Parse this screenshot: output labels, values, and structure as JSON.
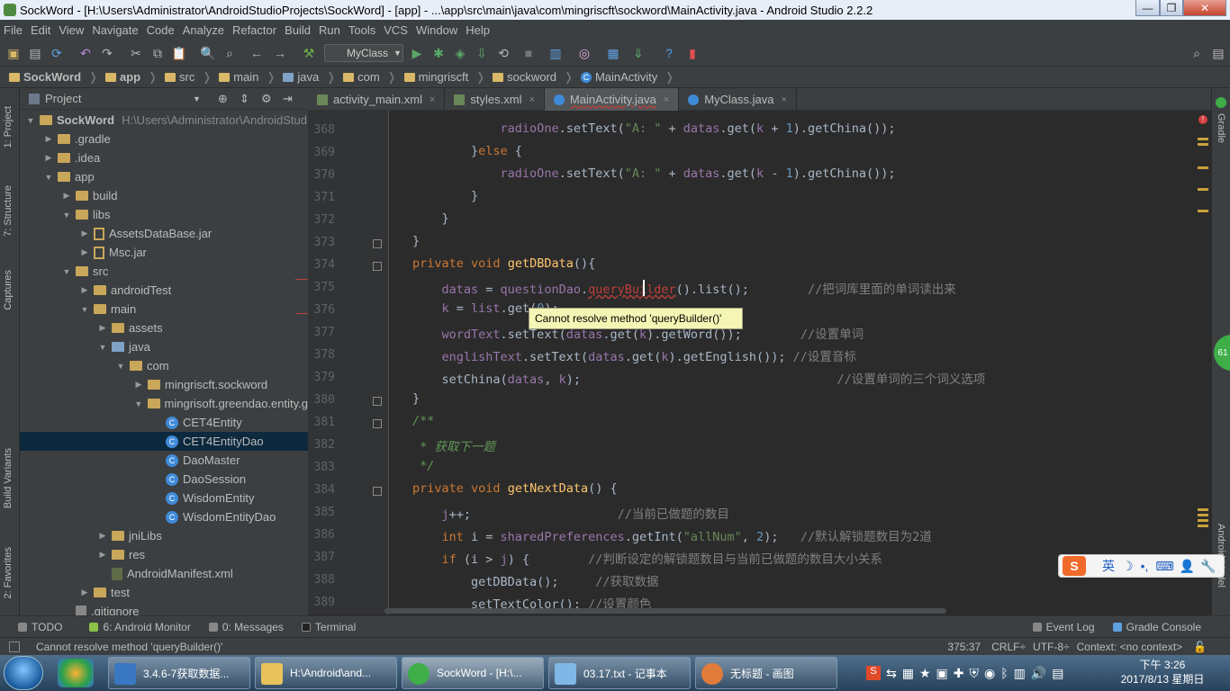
{
  "window": {
    "title": "SockWord - [H:\\Users\\Administrator\\AndroidStudioProjects\\SockWord] - [app] - ...\\app\\src\\main\\java\\com\\mingriscft\\sockword\\MainActivity.java - Android Studio 2.2.2"
  },
  "menu": [
    "File",
    "Edit",
    "View",
    "Navigate",
    "Code",
    "Analyze",
    "Refactor",
    "Build",
    "Run",
    "Tools",
    "VCS",
    "Window",
    "Help"
  ],
  "toolbar": {
    "run_config": "MyClass"
  },
  "breadcrumbs": [
    "SockWord",
    "app",
    "src",
    "main",
    "java",
    "com",
    "mingriscft",
    "sockword",
    "MainActivity"
  ],
  "project": {
    "header": "Project",
    "tree": [
      {
        "label": "SockWord",
        "extra": "H:\\Users\\Administrator\\AndroidStud",
        "depth": 0,
        "icon": "folder-icon",
        "expanded": true
      },
      {
        "label": ".gradle",
        "depth": 1,
        "icon": "folder-icon",
        "expanded": false
      },
      {
        "label": ".idea",
        "depth": 1,
        "icon": "folder-icon",
        "expanded": false
      },
      {
        "label": "app",
        "depth": 1,
        "icon": "folder-icon",
        "expanded": true
      },
      {
        "label": "build",
        "depth": 2,
        "icon": "folder-icon",
        "expanded": false
      },
      {
        "label": "libs",
        "depth": 2,
        "icon": "folder-icon",
        "expanded": true
      },
      {
        "label": "AssetsDataBase.jar",
        "depth": 3,
        "icon": "jar-icon",
        "expanded": false
      },
      {
        "label": "Msc.jar",
        "depth": 3,
        "icon": "jar-icon",
        "expanded": false
      },
      {
        "label": "src",
        "depth": 2,
        "icon": "folder-icon",
        "expanded": true
      },
      {
        "label": "androidTest",
        "depth": 3,
        "icon": "folder-icon",
        "expanded": false
      },
      {
        "label": "main",
        "depth": 3,
        "icon": "folder-icon",
        "expanded": true
      },
      {
        "label": "assets",
        "depth": 4,
        "icon": "folder-icon",
        "expanded": false
      },
      {
        "label": "java",
        "depth": 4,
        "icon": "folder-blue-icon",
        "expanded": true
      },
      {
        "label": "com",
        "depth": 5,
        "icon": "folder-icon",
        "expanded": true
      },
      {
        "label": "mingriscft.sockword",
        "depth": 6,
        "icon": "folder-icon",
        "expanded": false
      },
      {
        "label": "mingrisoft.greendao.entity.g",
        "depth": 6,
        "icon": "folder-icon",
        "expanded": true
      },
      {
        "label": "CET4Entity",
        "depth": 7,
        "icon": "class-icon",
        "leaf": true
      },
      {
        "label": "CET4EntityDao",
        "depth": 7,
        "icon": "class-icon",
        "leaf": true,
        "selected": true
      },
      {
        "label": "DaoMaster",
        "depth": 7,
        "icon": "class-icon",
        "leaf": true
      },
      {
        "label": "DaoSession",
        "depth": 7,
        "icon": "class-icon",
        "leaf": true
      },
      {
        "label": "WisdomEntity",
        "depth": 7,
        "icon": "class-icon",
        "leaf": true
      },
      {
        "label": "WisdomEntityDao",
        "depth": 7,
        "icon": "class-icon",
        "leaf": true
      },
      {
        "label": "jniLibs",
        "depth": 4,
        "icon": "folder-icon",
        "expanded": false
      },
      {
        "label": "res",
        "depth": 4,
        "icon": "folder-icon",
        "expanded": false
      },
      {
        "label": "AndroidManifest.xml",
        "depth": 4,
        "icon": "xml-icon",
        "leaf": true
      },
      {
        "label": "test",
        "depth": 3,
        "icon": "folder-icon",
        "expanded": false
      },
      {
        "label": ".gitignore",
        "depth": 2,
        "icon": "file-icon",
        "leaf": true
      }
    ]
  },
  "left_tabs": [
    "1: Project",
    "7: Structure",
    "Captures",
    "Build Variants",
    "2: Favorites"
  ],
  "right_tabs": [
    "Gradle",
    "Android Model"
  ],
  "tabs": [
    {
      "label": "activity_main.xml",
      "active": false
    },
    {
      "label": "styles.xml",
      "active": false
    },
    {
      "label": "MainActivity.java",
      "active": true
    },
    {
      "label": "MyClass.java",
      "active": false
    }
  ],
  "editor": {
    "line_numbers": [
      "368",
      "369",
      "370",
      "371",
      "372",
      "373",
      "374",
      "375",
      "376",
      "377",
      "378",
      "379",
      "380",
      "381",
      "382",
      "383",
      "384",
      "385",
      "386",
      "387",
      "388",
      "389"
    ],
    "tooltip": "Cannot resolve method 'queryBuilder()'",
    "code": [
      "            radioOne.setText(\"A: \" + datas.get(k + 1).getChina());",
      "        }else {",
      "            radioOne.setText(\"A: \" + datas.get(k - 1).getChina());",
      "        }",
      "    }",
      "}",
      "private void getDBData(){",
      "    datas = questionDao.queryBuilder().list();        //把词库里面的单词读出来",
      "    k = list.get(0);",
      "    wordText.setText(datas.get(k).getWord());        //设置单词",
      "    englishText.setText(datas.get(k).getEnglish()); //设置音标",
      "    setChina(datas, k);                                   //设置单词的三个词义选项",
      "}",
      "/**",
      " * 获取下一题",
      " */",
      "private void getNextData() {",
      "    j++;                    //当前已做题的数目",
      "    int i = sharedPreferences.getInt(\"allNum\", 2);   //默认解锁题数目为2道",
      "    if (i > j) {        //判断设定的解锁题数目与当前已做题的数目大小关系",
      "        getDBData();     //获取数据",
      "        setTextColor(); //设置颜色"
    ]
  },
  "bottom_tabs": [
    {
      "label": "TODO"
    },
    {
      "label": "6: Android Monitor"
    },
    {
      "label": "0: Messages"
    },
    {
      "label": "Terminal"
    },
    {
      "label": "Event Log"
    },
    {
      "label": "Gradle Console"
    }
  ],
  "status": {
    "message": "Cannot resolve method 'queryBuilder()'",
    "position": "375:37",
    "line_sep": "CRLF÷",
    "encoding": "UTF-8÷",
    "context": "Context: <no context>"
  },
  "gradle_badge": "61",
  "ime": {
    "label": "英"
  },
  "taskbar": {
    "tasks": [
      {
        "label": "3.4.6-7获取数据..."
      },
      {
        "label": "H:\\Android\\and..."
      },
      {
        "label": "SockWord - [H:\\..."
      },
      {
        "label": "03.17.txt - 记事本"
      },
      {
        "label": "无标题 - 画图"
      }
    ],
    "time": "下午 3:26",
    "date": "2017/8/13 星期日"
  }
}
